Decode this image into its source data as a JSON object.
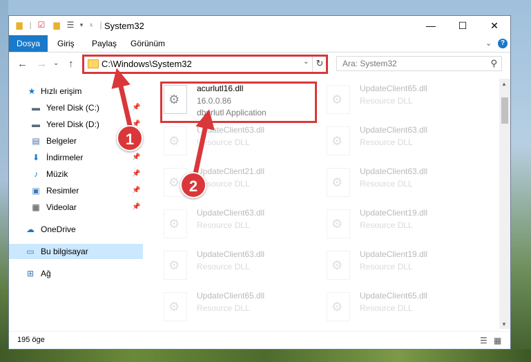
{
  "window": {
    "title": "System32",
    "controls": {
      "minimize": "—",
      "maximize": "☐",
      "close": "✕"
    }
  },
  "ribbon": {
    "file_tab": "Dosya",
    "tabs": [
      "Giriş",
      "Paylaş",
      "Görünüm"
    ],
    "help": "?"
  },
  "nav": {
    "back": "←",
    "forward": "→",
    "recent": "⌄",
    "up": "↑",
    "address": "C:\\Windows\\System32",
    "search_placeholder": "Ara: System32"
  },
  "sidebar": {
    "items": [
      {
        "label": "Hızlı erişim",
        "icon": "star-icon"
      },
      {
        "label": "Yerel Disk (C:)",
        "icon": "drive-icon",
        "pinned": true
      },
      {
        "label": "Yerel Disk (D:)",
        "icon": "drive-icon",
        "pinned": true
      },
      {
        "label": "Belgeler",
        "icon": "documents-icon",
        "pinned": true
      },
      {
        "label": "İndirmeler",
        "icon": "download-icon",
        "pinned": true
      },
      {
        "label": "Müzik",
        "icon": "music-icon",
        "pinned": true
      },
      {
        "label": "Resimler",
        "icon": "pictures-icon",
        "pinned": true
      },
      {
        "label": "Videolar",
        "icon": "video-icon",
        "pinned": true
      },
      {
        "label": "OneDrive",
        "icon": "cloud-icon"
      },
      {
        "label": "Bu bilgisayar",
        "icon": "computer-icon",
        "selected": true
      },
      {
        "label": "Ağ",
        "icon": "network-icon"
      }
    ]
  },
  "files": {
    "highlighted": {
      "name": "acurlutl16.dll",
      "version": "16.0.0.86",
      "description": "dburlutl Application"
    },
    "background": [
      {
        "name": "UpdateClient65.dll",
        "type": "Resource DLL"
      },
      {
        "name": "UpdateClient63.dll",
        "type": "Resource DLL"
      },
      {
        "name": "UpdateClient63.dll",
        "type": "Resource DLL"
      },
      {
        "name": "UpdateClient21.dll",
        "type": "Resource DLL"
      },
      {
        "name": "UpdateClient63.dll",
        "type": "Resource DLL"
      },
      {
        "name": "UpdateClient63.dll",
        "type": "Resource DLL"
      },
      {
        "name": "UpdateClient19.dll",
        "type": "Resource DLL"
      },
      {
        "name": "UpdateClient63.dll",
        "type": "Resource DLL"
      },
      {
        "name": "UpdateClient19.dll",
        "type": "Resource DLL"
      },
      {
        "name": "UpdateClient65.dll",
        "type": "Resource DLL"
      },
      {
        "name": "UpdateClient65.dll",
        "type": "Resource DLL"
      }
    ]
  },
  "status": {
    "count": "195 öge"
  },
  "callouts": {
    "one": "1",
    "two": "2"
  },
  "colors": {
    "accent": "#1979ca",
    "highlight": "#d9373a",
    "selected": "#cce8ff"
  }
}
